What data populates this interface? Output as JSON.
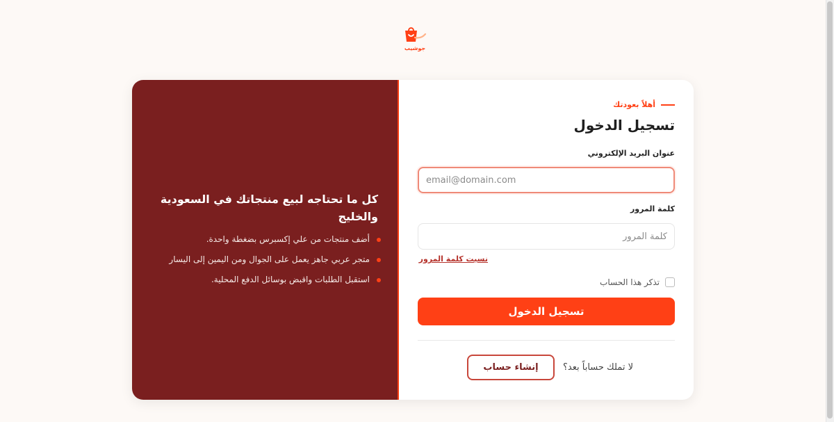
{
  "brand": {
    "logo_text": "جوشيب",
    "accent_color": "#ff4015",
    "promo_bg_color": "#7a1f1f",
    "icon": "shopping-bag-smile-icon"
  },
  "promo": {
    "title": "كل ما تحتاجه لبيع منتجاتك في السعودية والخليج",
    "points": [
      "أضف منتجات من علي إكسبرس بضغطة واحدة.",
      "متجر عربي جاهز يعمل على الجوال ومن اليمين إلى اليسار",
      "استقبل الطلبات واقبض بوسائل الدفع المحلية."
    ]
  },
  "login": {
    "eyebrow": "أهلاً بعودتك",
    "title": "تسجيل الدخول",
    "email_label": "عنوان البريد الإلكتروني",
    "email_placeholder": "email@domain.com",
    "email_value": "",
    "password_label": "كلمة المرور",
    "password_placeholder": "كلمة المرور",
    "password_value": "",
    "forgot_link": "نسيت كلمة المرور",
    "remember_label": "تذكر هذا الحساب",
    "remember_checked": false,
    "submit_label": "تسجيل الدخول",
    "no_account_text": "لا تملك حساباً بعد؟",
    "signup_label": "إنشاء حساب"
  }
}
